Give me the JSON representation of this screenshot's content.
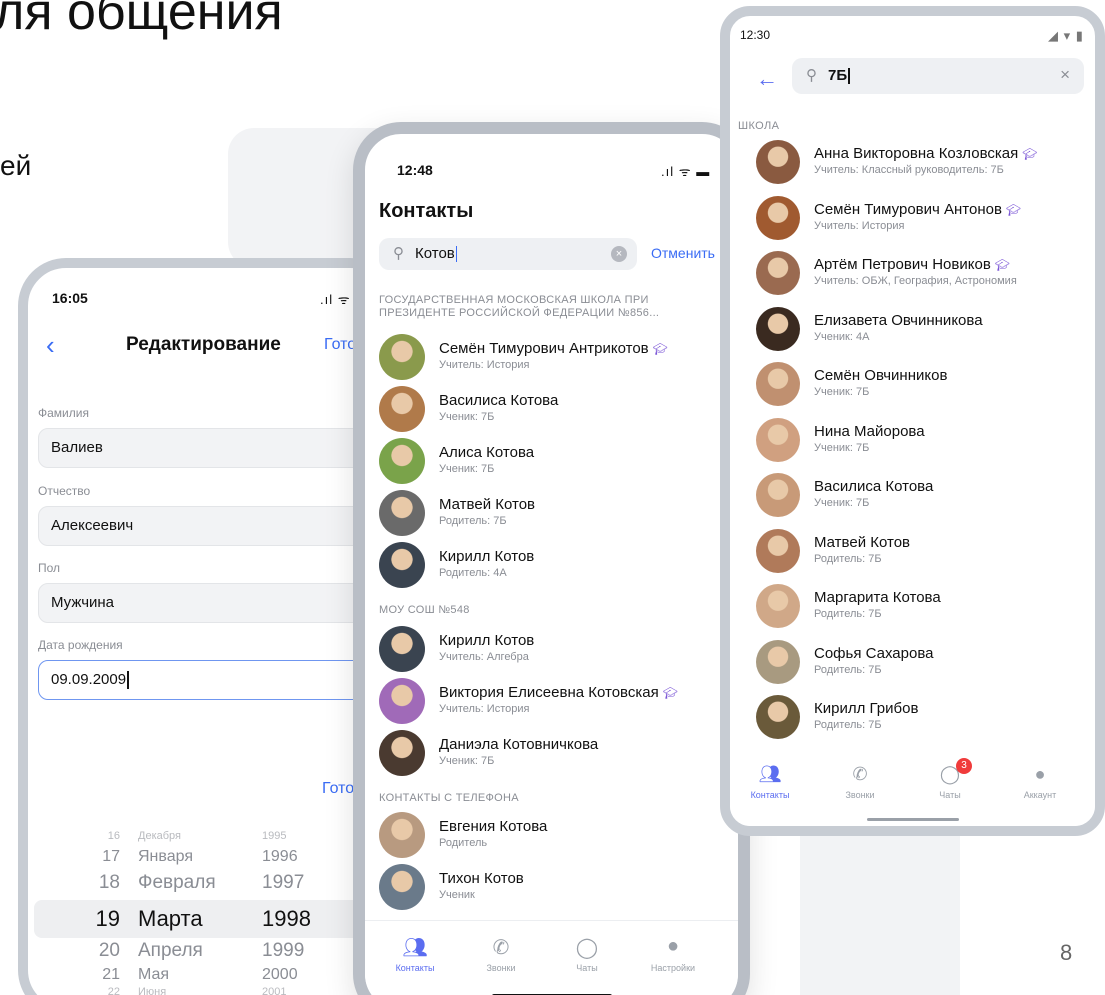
{
  "slide": {
    "heading": "ля общения",
    "fragment": "ей",
    "page_number": "8"
  },
  "edit_screen": {
    "time": "16:05",
    "status_icons": "signal-wifi",
    "title": "Редактирование",
    "done_label": "Готово",
    "fields": [
      {
        "label": "Фамилия",
        "value": "Валиев"
      },
      {
        "label": "Отчество",
        "value": "Алексеевич"
      },
      {
        "label": "Пол",
        "value": "Мужчина"
      },
      {
        "label": "Дата рождения",
        "value": "09.09.2009"
      }
    ],
    "picker_done": "Готово",
    "picker_rows": [
      {
        "day": "16",
        "month": "Декабря",
        "year": "1995"
      },
      {
        "day": "17",
        "month": "Января",
        "year": "1996"
      },
      {
        "day": "18",
        "month": "Февраля",
        "year": "1997"
      },
      {
        "day": "19",
        "month": "Марта",
        "year": "1998"
      },
      {
        "day": "20",
        "month": "Апреля",
        "year": "1999"
      },
      {
        "day": "21",
        "month": "Мая",
        "year": "2000"
      },
      {
        "day": "22",
        "month": "Июня",
        "year": "2001"
      }
    ]
  },
  "contacts_screen": {
    "time": "12:48",
    "title": "Контакты",
    "search_value": "Котов",
    "cancel_label": "Отменить",
    "sections": [
      {
        "title": "ГОСУДАРСТВЕННАЯ МОСКОВСКАЯ ШКОЛА ПРИ ПРЕЗИДЕНТЕ РОССИЙСКОЙ ФЕДЕРАЦИИ №856...",
        "items": [
          {
            "name": "Семён Тимурович Антрикотов",
            "sub": "Учитель: История",
            "teacher": true,
            "color": "#8a9a4c"
          },
          {
            "name": "Василиса Котова",
            "sub": "Ученик: 7Б",
            "teacher": false,
            "color": "#b07a4a"
          },
          {
            "name": "Алиса Котова",
            "sub": "Ученик: 7Б",
            "teacher": false,
            "color": "#7aa34a"
          },
          {
            "name": "Матвей Котов",
            "sub": "Родитель: 7Б",
            "teacher": false,
            "color": "#6a6a6a"
          },
          {
            "name": "Кирилл Котов",
            "sub": "Родитель: 4А",
            "teacher": false,
            "color": "#3a4450"
          }
        ]
      },
      {
        "title": "МОУ СОШ №548",
        "items": [
          {
            "name": "Кирилл Котов",
            "sub": "Учитель: Алгебра",
            "teacher": false,
            "color": "#3a4450"
          },
          {
            "name": "Виктория Елисеевна Котовская",
            "sub": "Учитель: История",
            "teacher": true,
            "color": "#a06ab8"
          },
          {
            "name": "Даниэла Котовничкова",
            "sub": "Ученик: 7Б",
            "teacher": false,
            "color": "#4a3a30"
          }
        ]
      },
      {
        "title": "КОНТАКТЫ С ТЕЛЕФОНА",
        "items": [
          {
            "name": "Евгения Котова",
            "sub": "Родитель",
            "teacher": false,
            "color": "#b89a80"
          },
          {
            "name": "Тихон Котов",
            "sub": "Ученик",
            "teacher": false,
            "color": "#6a7a8a"
          }
        ]
      }
    ],
    "tabs": [
      {
        "label": "Контакты",
        "icon": "people-icon",
        "active": true
      },
      {
        "label": "Звонки",
        "icon": "phone-icon",
        "active": false
      },
      {
        "label": "Чаты",
        "icon": "chat-icon",
        "active": false
      },
      {
        "label": "Настройки",
        "icon": "avatar-icon",
        "active": false
      }
    ]
  },
  "android_screen": {
    "time": "12:30",
    "search_value": "7Б",
    "section": "ШКОЛА",
    "items": [
      {
        "name": "Анна Викторовна Козловская",
        "sub": "Учитель: Классный руководитель: 7Б",
        "teacher": true,
        "color": "#8a5a40"
      },
      {
        "name": "Семён Тимурович Антонов",
        "sub": "Учитель: История",
        "teacher": true,
        "color": "#a05a30"
      },
      {
        "name": "Артём Петрович Новиков",
        "sub": "Учитель: ОБЖ, География, Астрономия",
        "teacher": true,
        "color": "#9a6a50"
      },
      {
        "name": "Елизавета Овчинникова",
        "sub": "Ученик: 4А",
        "teacher": false,
        "color": "#3a2a20"
      },
      {
        "name": "Семён Овчинников",
        "sub": "Ученик: 7Б",
        "teacher": false,
        "color": "#c09070"
      },
      {
        "name": "Нина Майорова",
        "sub": "Ученик: 7Б",
        "teacher": false,
        "color": "#d0a080"
      },
      {
        "name": "Василиса Котова",
        "sub": "Ученик: 7Б",
        "teacher": false,
        "color": "#c89a78"
      },
      {
        "name": "Матвей Котов",
        "sub": "Родитель: 7Б",
        "teacher": false,
        "color": "#b07a5a"
      },
      {
        "name": "Маргарита Котова",
        "sub": "Родитель: 7Б",
        "teacher": false,
        "color": "#d0a888"
      },
      {
        "name": "Софья Сахарова",
        "sub": "Родитель: 7Б",
        "teacher": false,
        "color": "#a89a80"
      },
      {
        "name": "Кирилл Грибов",
        "sub": "Родитель: 7Б",
        "teacher": false,
        "color": "#6a5a3a"
      }
    ],
    "tabs": [
      {
        "label": "Контакты",
        "icon": "people-icon",
        "active": true
      },
      {
        "label": "Звонки",
        "icon": "phone-icon",
        "active": false
      },
      {
        "label": "Чаты",
        "icon": "chat-icon",
        "active": false,
        "badge": "3"
      },
      {
        "label": "Аккаунт",
        "icon": "avatar-icon",
        "active": false
      }
    ]
  },
  "colors": {
    "accent": "#3a6cf4",
    "tab_active": "#5b6df0",
    "teacher_badge": "#7a55d6",
    "notification": "#f03b3b"
  }
}
